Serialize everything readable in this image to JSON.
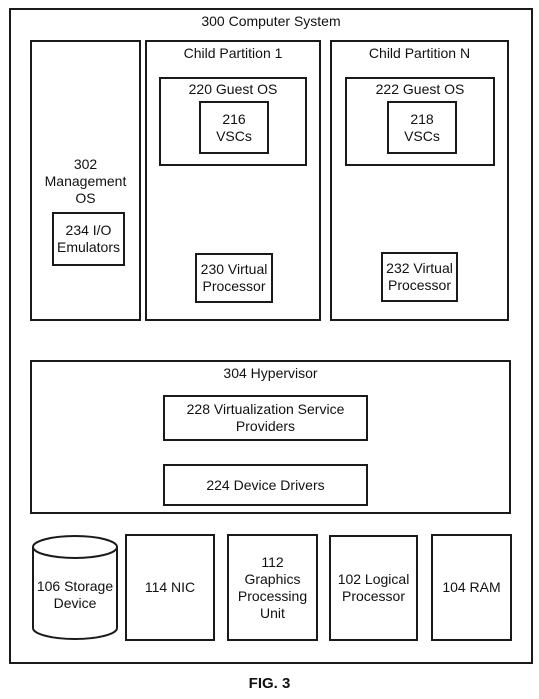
{
  "figure": {
    "caption": "FIG. 3",
    "computer_system": {
      "label": "300 Computer System"
    },
    "management_os": {
      "label": "302\nManagement\nOS",
      "io_emulators": "234 I/O\nEmulators"
    },
    "child_partition_1": {
      "label": "Child Partition 1",
      "guest_os": "220 Guest OS",
      "vscs": "216\nVSCs",
      "virtual_processor": "230 Virtual\nProcessor"
    },
    "child_partition_n": {
      "label": "Child Partition N",
      "guest_os": "222 Guest OS",
      "vscs": "218\nVSCs",
      "virtual_processor": "232 Virtual\nProcessor"
    },
    "hypervisor": {
      "label": "304 Hypervisor",
      "vsp": "228 Virtualization Service\nProviders",
      "device_drivers": "224 Device Drivers"
    },
    "hardware": {
      "storage": "106 Storage\nDevice",
      "nic": "114 NIC",
      "gpu": "112\nGraphics\nProcessing\nUnit",
      "logical_processor": "102 Logical\nProcessor",
      "ram": "104 RAM"
    }
  }
}
